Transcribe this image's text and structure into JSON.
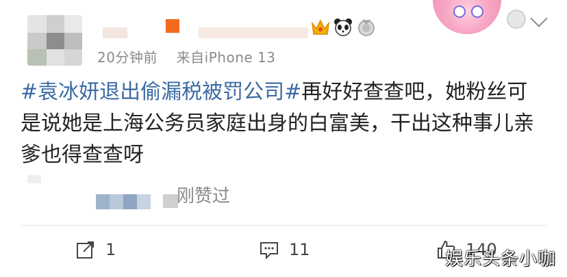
{
  "post": {
    "meta_time": "20分钟前",
    "meta_source": "来自iPhone 13",
    "hashtag": "#袁冰妍退出偷漏税被罚公司#",
    "body_text": "再好好查查吧，她粉丝可是说她是上海公务员家庭出身的白富美，干出这种事儿亲爹也得查查呀"
  },
  "liked": {
    "label": "刚赞过"
  },
  "actions": {
    "repost_count": "1",
    "comment_count": "11",
    "like_count": "140"
  },
  "watermark": "娱乐头条小咖",
  "icons": {
    "crown": "crown-badge-icon",
    "panda": "panda-badge-icon",
    "medal": "medal-badge-icon",
    "repost": "share-icon",
    "comment": "comment-icon",
    "like": "thumbs-up-icon"
  },
  "colors": {
    "hashtag": "#3b6aa3",
    "meta": "#8a8a8a"
  }
}
